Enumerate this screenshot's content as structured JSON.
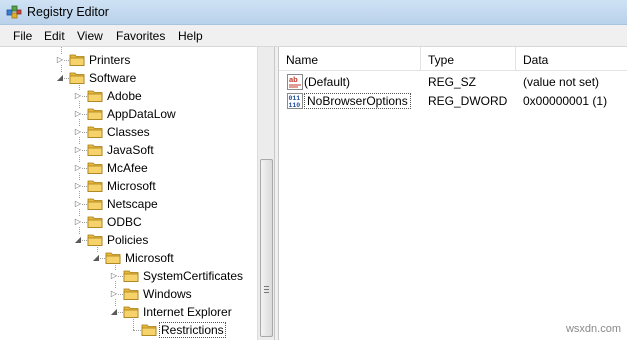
{
  "window": {
    "title": "Registry Editor",
    "icon": "registry-editor-icon"
  },
  "menu": [
    "File",
    "Edit",
    "View",
    "Favorites",
    "Help"
  ],
  "tree": {
    "nodes": [
      {
        "label": "Printers",
        "expander": "collapsed",
        "level": 3
      },
      {
        "label": "Software",
        "expander": "expanded",
        "level": 3
      },
      {
        "label": "Adobe",
        "expander": "collapsed",
        "level": 4
      },
      {
        "label": "AppDataLow",
        "expander": "collapsed",
        "level": 4
      },
      {
        "label": "Classes",
        "expander": "collapsed",
        "level": 4
      },
      {
        "label": "JavaSoft",
        "expander": "collapsed",
        "level": 4
      },
      {
        "label": "McAfee",
        "expander": "collapsed",
        "level": 4
      },
      {
        "label": "Microsoft",
        "expander": "collapsed",
        "level": 4
      },
      {
        "label": "Netscape",
        "expander": "collapsed",
        "level": 4
      },
      {
        "label": "ODBC",
        "expander": "collapsed",
        "level": 4
      },
      {
        "label": "Policies",
        "expander": "expanded",
        "level": 4
      },
      {
        "label": "Microsoft",
        "expander": "expanded",
        "level": 5
      },
      {
        "label": "SystemCertificates",
        "expander": "collapsed",
        "level": 6
      },
      {
        "label": "Windows",
        "expander": "collapsed",
        "level": 6
      },
      {
        "label": "Internet Explorer",
        "expander": "expanded",
        "level": 6
      },
      {
        "label": "Restrictions",
        "expander": "none",
        "level": 7,
        "selected": true
      }
    ]
  },
  "list": {
    "columns": [
      "Name",
      "Type",
      "Data"
    ],
    "rows": [
      {
        "icon": "string-value-icon",
        "name": "(Default)",
        "type": "REG_SZ",
        "data": "(value not set)"
      },
      {
        "icon": "dword-value-icon",
        "name": "NoBrowserOptions",
        "type": "REG_DWORD",
        "data": "0x00000001 (1)",
        "focused": true
      }
    ]
  },
  "watermark": "wsxdn.com",
  "colors": {
    "folder": "#e8b83a",
    "titlebar": "#c4daf0",
    "string_icon_red": "#c0392b",
    "dword_icon_blue": "#1f4e9c"
  }
}
